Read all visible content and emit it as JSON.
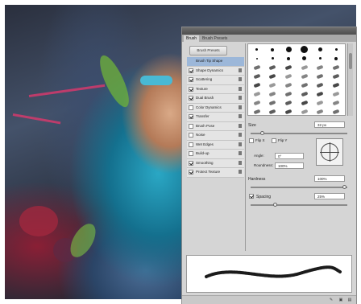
{
  "panel": {
    "tabs": [
      "Brush",
      "Brush Presets"
    ],
    "presets_button": "Brush Presets",
    "options": [
      {
        "label": "Brush Tip Shape",
        "checkbox": false,
        "checked": false,
        "selected": true
      },
      {
        "label": "Shape Dynamics",
        "checkbox": true,
        "checked": true,
        "selected": false
      },
      {
        "label": "Scattering",
        "checkbox": true,
        "checked": true,
        "selected": false
      },
      {
        "label": "Texture",
        "checkbox": true,
        "checked": true,
        "selected": false
      },
      {
        "label": "Dual Brush",
        "checkbox": true,
        "checked": true,
        "selected": false
      },
      {
        "label": "Color Dynamics",
        "checkbox": true,
        "checked": false,
        "selected": false
      },
      {
        "label": "Transfer",
        "checkbox": true,
        "checked": true,
        "selected": false
      },
      {
        "label": "Brush Pose",
        "checkbox": true,
        "checked": false,
        "selected": false
      },
      {
        "label": "Noise",
        "checkbox": true,
        "checked": false,
        "selected": false
      },
      {
        "label": "Wet Edges",
        "checkbox": true,
        "checked": false,
        "selected": false
      },
      {
        "label": "Build-up",
        "checkbox": true,
        "checked": false,
        "selected": false
      },
      {
        "label": "Smoothing",
        "checkbox": true,
        "checked": true,
        "selected": false
      },
      {
        "label": "Protect Texture",
        "checkbox": true,
        "checked": true,
        "selected": false
      }
    ],
    "size_label": "Size",
    "size_value": "32 px",
    "size_slider_value": 0.12,
    "flip_x": "Flip X",
    "flip_y": "Flip Y",
    "angle_label": "Angle:",
    "angle_value": "0°",
    "roundness_label": "Roundness:",
    "roundness_value": "100%",
    "hardness_label": "Hardness",
    "hardness_value": "100%",
    "spacing_label": "Spacing",
    "spacing_value": "25%",
    "spacing_checked": true,
    "spacing_slider_value": 0.25,
    "footer_icons": [
      "brush-icon",
      "new-icon",
      "trash-icon"
    ]
  }
}
